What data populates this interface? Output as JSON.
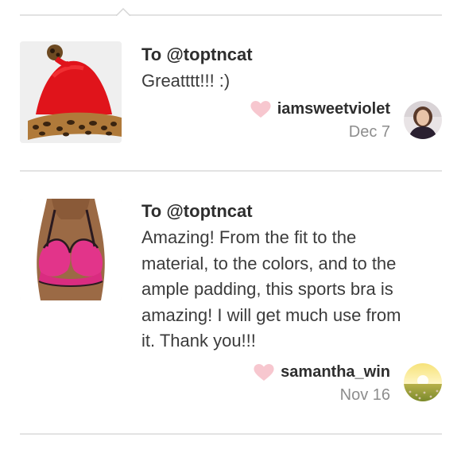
{
  "reviews": [
    {
      "to": "To @toptncat",
      "message": "Greatttt!!! :)",
      "username": "iamsweetviolet",
      "date": "Dec 7",
      "item_image": "santa-hat",
      "avatar": "woman-portrait"
    },
    {
      "to": "To @toptncat",
      "message_lines": [
        "Amazing! From the fit to the",
        "material, to the colors, and to the",
        "ample padding, this sports bra is",
        "amazing! I will get much use from",
        "it. Thank you!!!"
      ],
      "username": "samantha_win",
      "date": "Nov 16",
      "item_image": "pink-sports-bra",
      "avatar": "sunset-field"
    }
  ],
  "icons": {
    "like": "heart-icon"
  },
  "colors": {
    "heart": "#f7c7cf",
    "divider": "#e3e3e3",
    "date": "#8d8d8d"
  }
}
